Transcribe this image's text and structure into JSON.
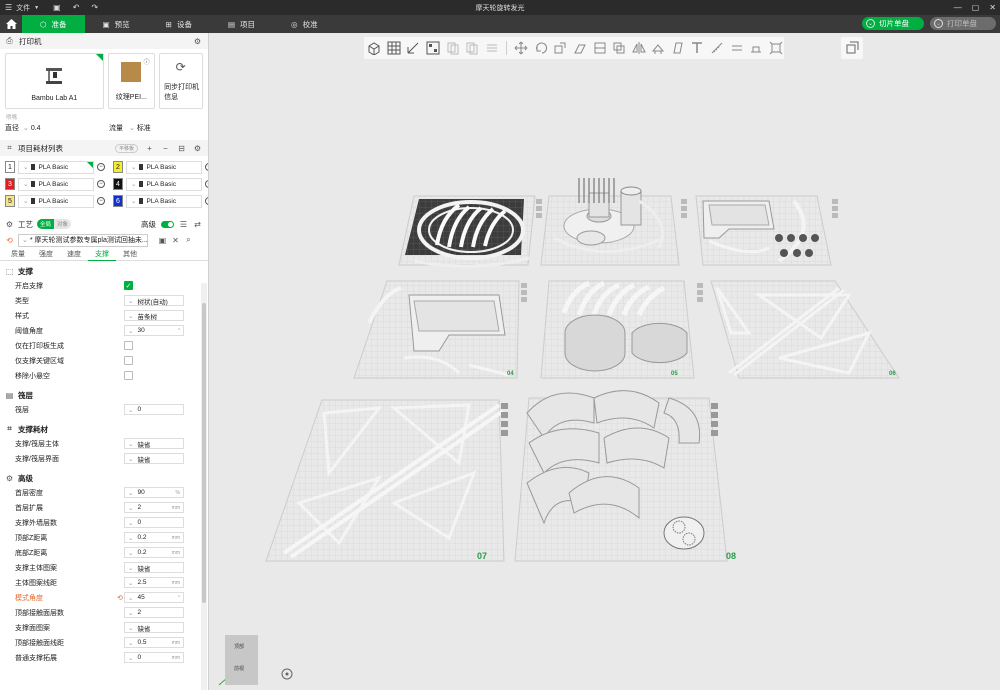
{
  "titlebar": {
    "menu_label": "文件",
    "title": "摩天轮旋转发光"
  },
  "nav": {
    "tabs": [
      {
        "label": "准备",
        "active": true
      },
      {
        "label": "预览",
        "active": false
      },
      {
        "label": "设备",
        "active": false
      },
      {
        "label": "项目",
        "active": false
      },
      {
        "label": "校准",
        "active": false
      }
    ],
    "slice_label": "切片单盘",
    "print_label": "打印单盘"
  },
  "printer": {
    "section_title": "打印机",
    "printer_name": "Bambu Lab A1",
    "plate_name": "纹理PEI...",
    "sync_label_1": "同步打印机",
    "sync_label_2": "信息",
    "nozzle_caption": "喷嘴",
    "diameter_label": "直径",
    "diameter_value": "0.4",
    "flow_label": "流量",
    "flow_value": "标准"
  },
  "filaments": {
    "section_title": "项目耗材列表",
    "badge": "平移板",
    "items": [
      {
        "num": "1",
        "name": "PLA Basic",
        "color": "#ffffff",
        "text_color": "#222"
      },
      {
        "num": "2",
        "name": "PLA Basic",
        "color": "#f5ec2a",
        "text_color": "#222"
      },
      {
        "num": "3",
        "name": "PLA Basic",
        "color": "#e02020",
        "text_color": "#fff"
      },
      {
        "num": "4",
        "name": "PLA Basic",
        "color": "#111111",
        "text_color": "#fff"
      },
      {
        "num": "5",
        "name": "PLA Basic",
        "color": "#f7e58a",
        "text_color": "#222"
      },
      {
        "num": "6",
        "name": "PLA Basic",
        "color": "#1030d0",
        "text_color": "#fff"
      }
    ]
  },
  "process": {
    "section_title": "工艺",
    "toggle_global": "全局",
    "toggle_object": "对象",
    "advanced_label": "高级",
    "preset": "* 摩天轮测试参数专属pla测试回抽未...",
    "tabs": [
      "质量",
      "强度",
      "速度",
      "支撑",
      "其他"
    ],
    "active_tab": "支撑"
  },
  "support": {
    "title": "支撑",
    "rows": [
      {
        "label": "开启支撑",
        "type": "check",
        "on": true
      },
      {
        "label": "类型",
        "value": "树状(自动)"
      },
      {
        "label": "样式",
        "value": "苗条树"
      },
      {
        "label": "阈值角度",
        "value": "30",
        "unit": "°"
      },
      {
        "label": "仅在打印板生成",
        "type": "check",
        "on": false
      },
      {
        "label": "仅支撑关键区域",
        "type": "check",
        "on": false
      },
      {
        "label": "移除小悬空",
        "type": "check",
        "on": false
      }
    ]
  },
  "raft": {
    "title": "筏层",
    "rows": [
      {
        "label": "筏层",
        "value": "0"
      }
    ]
  },
  "support_filament": {
    "title": "支撑耗材",
    "rows": [
      {
        "label": "支撑/筏层主体",
        "value": "缺省"
      },
      {
        "label": "支撑/筏层界面",
        "value": "缺省"
      }
    ]
  },
  "advanced": {
    "title": "高级",
    "rows": [
      {
        "label": "首层密度",
        "value": "90",
        "unit": "%"
      },
      {
        "label": "首层扩展",
        "value": "2",
        "unit": "mm"
      },
      {
        "label": "支撑外墙层数",
        "value": "0"
      },
      {
        "label": "顶部Z距离",
        "value": "0.2",
        "unit": "mm"
      },
      {
        "label": "底部Z距离",
        "value": "0.2",
        "unit": "mm"
      },
      {
        "label": "支撑主体图案",
        "value": "缺省"
      },
      {
        "label": "主体图案线距",
        "value": "2.5",
        "unit": "mm"
      },
      {
        "label": "模式角度",
        "value": "45",
        "unit": "°",
        "warn": true
      },
      {
        "label": "顶部接触面层数",
        "value": "2"
      },
      {
        "label": "支撑面图案",
        "value": "缺省"
      },
      {
        "label": "顶部接触面线距",
        "value": "0.5",
        "unit": "mm"
      },
      {
        "label": "普通支撑拓展",
        "value": "0",
        "unit": "mm"
      }
    ]
  },
  "plates": {
    "labels": [
      "04",
      "05",
      "06",
      "07",
      "08"
    ]
  },
  "minimap": {
    "top_label": "顶部",
    "bottom_label": "前视"
  }
}
